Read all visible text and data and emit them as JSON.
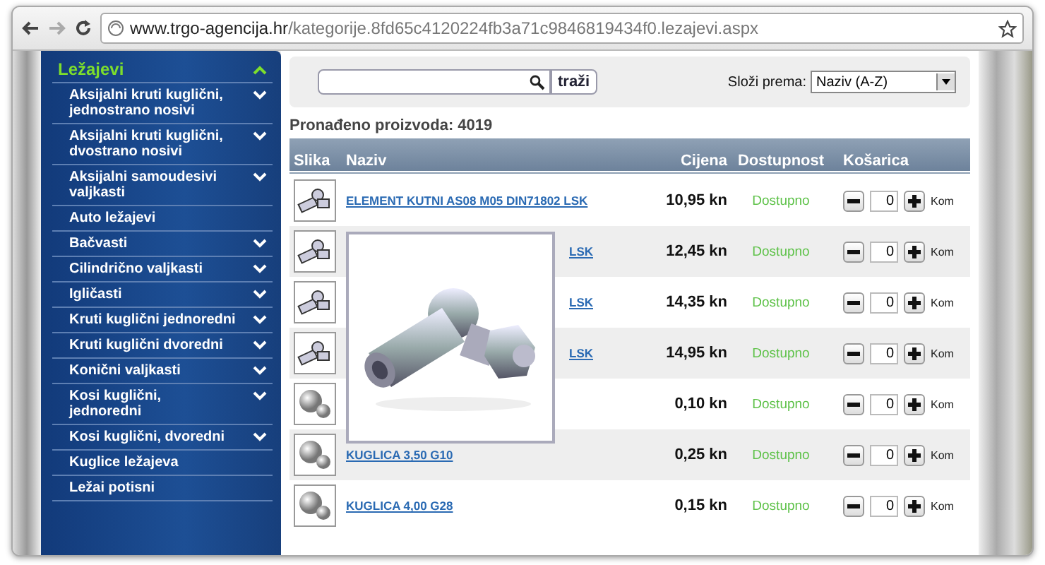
{
  "browser": {
    "url_host": "www.trgo-agencija.hr",
    "url_path": "/kategorije.8fd65c4120224fb3a71c9846819434f0.lezajevi.aspx"
  },
  "sidebar": {
    "heading": {
      "label": "Ležajevi",
      "expanded": true
    },
    "items": [
      {
        "label": "Aksijalni kruti kuglični, jednostrano nosivi",
        "expandable": true
      },
      {
        "label": "Aksijalni kruti kuglični, dvostrano nosivi",
        "expandable": true
      },
      {
        "label": "Aksijalni samoudesivi valjkasti",
        "expandable": true
      },
      {
        "label": "Auto ležajevi",
        "expandable": false
      },
      {
        "label": "Bačvasti",
        "expandable": true
      },
      {
        "label": "Cilindrično valjkasti",
        "expandable": true
      },
      {
        "label": "Igličasti",
        "expandable": true
      },
      {
        "label": "Kruti kuglični jednoredni",
        "expandable": true
      },
      {
        "label": "Kruti kuglični dvoredni",
        "expandable": true
      },
      {
        "label": "Konični valjkasti",
        "expandable": true
      },
      {
        "label": "Kosi kuglični, jednoredni",
        "expandable": true
      },
      {
        "label": "Kosi kuglični, dvoredni",
        "expandable": true
      },
      {
        "label": "Kuglice ležajeva",
        "expandable": false
      },
      {
        "label": "Ležai potisni",
        "expandable": false
      }
    ]
  },
  "search": {
    "button": "traži",
    "sort_label": "Složi prema:",
    "sort_value": "Naziv (A-Z)"
  },
  "found": "Pronađeno proizvoda: 4019",
  "table": {
    "columns": [
      "Slika",
      "Naziv",
      "Cijena",
      "Dostupnost",
      "Košarica"
    ],
    "rows": [
      {
        "kind": "joint",
        "name": "ELEMENT KUTNI AS08 M05 DIN71802 LSK",
        "covered": false,
        "price": "10,95 kn",
        "availability": "Dostupno",
        "qty": "0",
        "unit": "Kom"
      },
      {
        "kind": "joint",
        "name": "LSK",
        "covered": true,
        "price": "12,45 kn",
        "availability": "Dostupno",
        "qty": "0",
        "unit": "Kom"
      },
      {
        "kind": "joint",
        "name": "LSK",
        "covered": true,
        "price": "14,35 kn",
        "availability": "Dostupno",
        "qty": "0",
        "unit": "Kom"
      },
      {
        "kind": "joint",
        "name": "LSK",
        "covered": true,
        "price": "14,95 kn",
        "availability": "Dostupno",
        "qty": "0",
        "unit": "Kom"
      },
      {
        "kind": "ball",
        "price": "0,10 kn",
        "availability": "Dostupno",
        "qty": "0",
        "unit": "Kom"
      },
      {
        "kind": "ball",
        "name": "KUGLICA 3,50 G10",
        "covered": false,
        "price": "0,25 kn",
        "availability": "Dostupno",
        "qty": "0",
        "unit": "Kom"
      },
      {
        "kind": "ball",
        "name": "KUGLICA 4,00 G28",
        "covered": false,
        "price": "0,15 kn",
        "availability": "Dostupno",
        "qty": "0",
        "unit": "Kom"
      }
    ]
  }
}
